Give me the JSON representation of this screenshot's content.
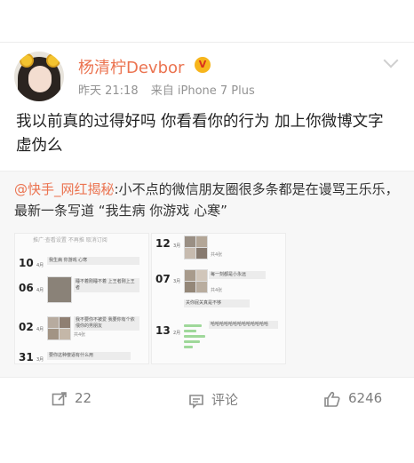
{
  "user": {
    "name": "杨清柠Devbor",
    "time": "昨天 21:18",
    "source": "来自 iPhone 7 Plus",
    "vip_badge": "V"
  },
  "post": {
    "text": "我以前真的过得好吗 你看看你的行为 加上你微博文字 虚伪么"
  },
  "repost": {
    "mention": "@快手_网红揭秘",
    "text": ":小不点的微信朋友圈很多条都是在谩骂王乐乐，最新一条写道 “我生病 你游戏 心寒”"
  },
  "thumb1": {
    "header": "推广·查看设置 不再推 取消订阅",
    "entries": [
      {
        "day": "10",
        "month": "4月",
        "text": "我生病 你游戏 心寒"
      },
      {
        "day": "06",
        "month": "4月",
        "text": "睡不着刚睡不着 上王者刚上王者"
      },
      {
        "day": "02",
        "month": "4月",
        "text": "我不要你不被爱 我要你有个依偎你的男朋友"
      },
      {
        "day": "31",
        "month": "3月",
        "text": "要你这种傻逼有什么用"
      }
    ],
    "counts": [
      "共4张",
      "共4张"
    ]
  },
  "thumb2": {
    "entries": [
      {
        "day": "12",
        "month": "3月",
        "text": "共4张"
      },
      {
        "day": "07",
        "month": "3月",
        "text": "每一刻都是小永远"
      },
      {
        "day": "13",
        "month": "2月",
        "text": "哈哈哈哈哈哈哈哈哈哈哈哈哈"
      }
    ],
    "extra": "关你屁关真是不够",
    "counts": [
      "共4张",
      "共4张"
    ]
  },
  "actions": {
    "repost_count": "22",
    "comment_label": "评论",
    "like_count": "6246"
  },
  "colors": {
    "accent": "#eb7350",
    "muted": "#939393",
    "repost_bg": "#f7f7f7"
  }
}
